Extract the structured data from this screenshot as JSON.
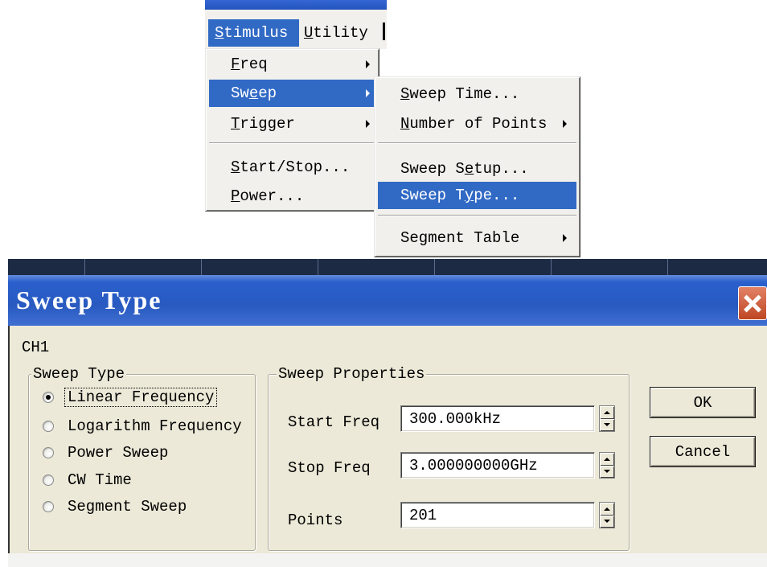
{
  "menubar": {
    "items": [
      {
        "label": "Stimulus",
        "underlined_char_index": 0,
        "active": true
      },
      {
        "label": "Utility",
        "underlined_char_index": 0,
        "active": false
      }
    ]
  },
  "stimulus_menu": {
    "items": [
      {
        "label": "Freq",
        "underlined_char_index": 0,
        "submenu": true,
        "highlighted": false
      },
      {
        "label": "Sweep",
        "underlined_char_index": 2,
        "submenu": true,
        "highlighted": true
      },
      {
        "label": "Trigger",
        "underlined_char_index": 0,
        "submenu": true,
        "highlighted": false
      },
      {
        "label": "Start/Stop...",
        "underlined_char_index": 0,
        "submenu": false,
        "highlighted": false
      },
      {
        "label": "Power...",
        "underlined_char_index": 0,
        "submenu": false,
        "highlighted": false
      }
    ]
  },
  "sweep_submenu": {
    "items": [
      {
        "label": "Sweep Time...",
        "underlined_char_index": 0,
        "submenu": false,
        "highlighted": false
      },
      {
        "label": "Number of Points",
        "underlined_char_index": 0,
        "submenu": true,
        "highlighted": false
      },
      {
        "label": "Sweep Setup...",
        "underlined_char_index": 7,
        "submenu": false,
        "highlighted": false
      },
      {
        "label": "Sweep Type...",
        "underlined_char_index": 7,
        "submenu": false,
        "highlighted": true
      },
      {
        "label": "Segment Table",
        "underlined_char_index": null,
        "submenu": true,
        "highlighted": false
      }
    ]
  },
  "dialog": {
    "title": "Sweep Type",
    "channel": "CH1",
    "sweep_type_group": {
      "title": "Sweep Type",
      "options": [
        {
          "label": "Linear Frequency",
          "selected": true,
          "focused": true
        },
        {
          "label": "Logarithm Frequency",
          "selected": false,
          "focused": false
        },
        {
          "label": "Power Sweep",
          "selected": false,
          "focused": false
        },
        {
          "label": "CW Time",
          "selected": false,
          "focused": false
        },
        {
          "label": "Segment Sweep",
          "selected": false,
          "focused": false
        }
      ]
    },
    "properties_group": {
      "title": "Sweep Properties",
      "fields": [
        {
          "label": "Start Freq",
          "value": "300.000kHz"
        },
        {
          "label": "Stop Freq",
          "value": "3.000000000GHz"
        },
        {
          "label": "Points",
          "value": "201"
        }
      ]
    },
    "buttons": {
      "ok": "OK",
      "cancel": "Cancel"
    }
  },
  "colors": {
    "menu_highlight": "#316AC5",
    "menu_background": "#F1F0EC",
    "dialog_background": "#ECE9D8",
    "title_bar": "#2A5FCC",
    "close_button": "#D8512A"
  },
  "icons": {
    "submenu_arrow": "triangle-right-icon",
    "close": "close-icon",
    "spin_up": "triangle-up-icon",
    "spin_down": "triangle-down-icon",
    "radio": "radio-button-icon"
  }
}
